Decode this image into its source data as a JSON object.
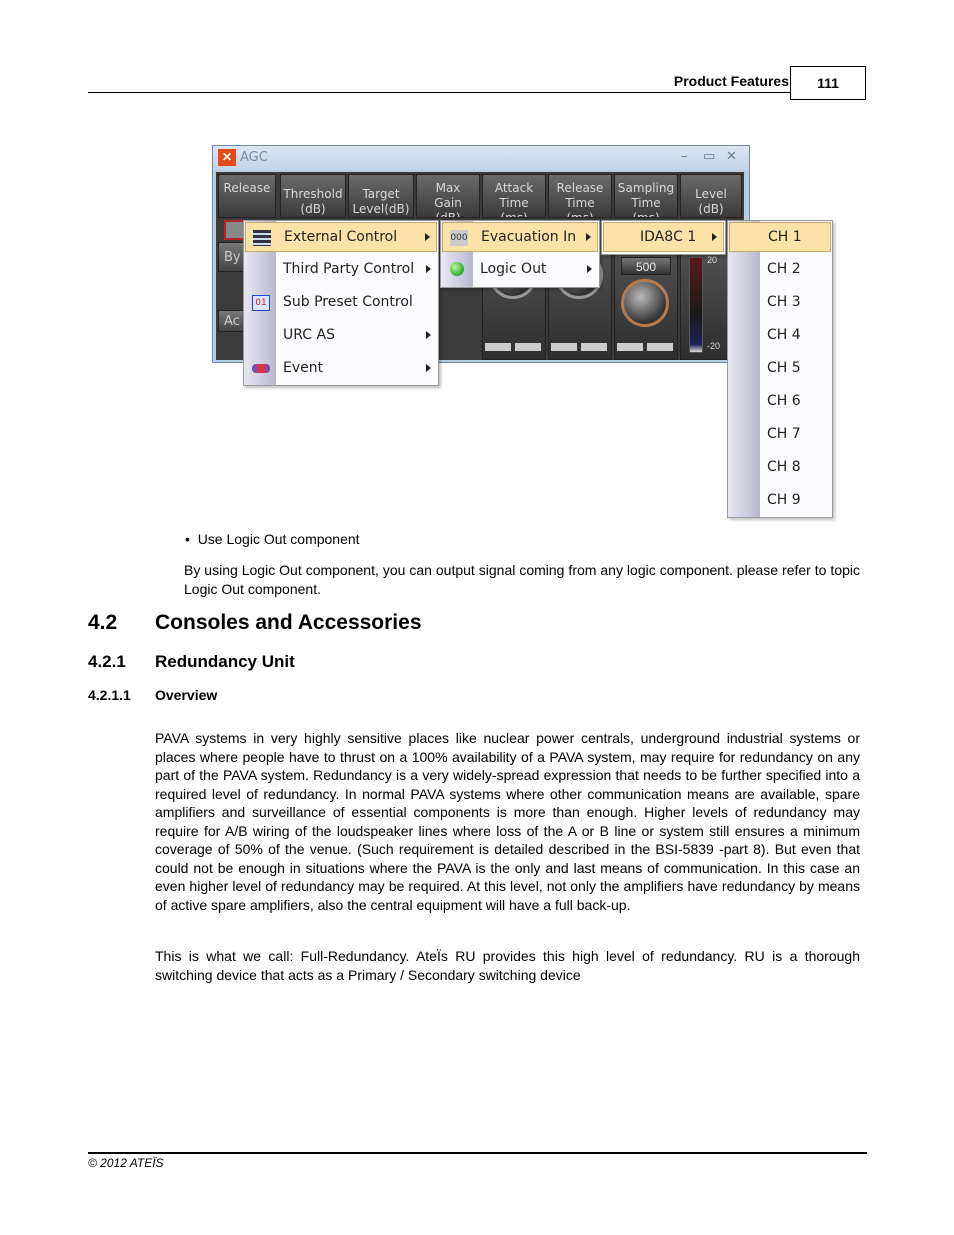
{
  "header": {
    "section_title": "Product Features",
    "page_number": "111"
  },
  "screenshot": {
    "window": {
      "title": "AGC",
      "controls": {
        "minimize": "–",
        "maximize": "▭",
        "close": "✕"
      },
      "column_headers": [
        "Release",
        "Threshold\n(dB)",
        "Target\nLevel(dB)",
        "Max\nGain\n(dB)",
        "Attack\nTime\n(ms)",
        "Release\nTime\n(ms)",
        "Sampling\nTime\n(ms)",
        "Level\n(dB)"
      ],
      "left_buttons": [
        "By",
        "Ac"
      ],
      "sampling_value": "500",
      "meter_top": "20",
      "meter_bottom": "-20"
    },
    "menu_main": {
      "items": [
        {
          "label": "External Control",
          "icon": "external-control-icon",
          "submenu": true,
          "highlighted": true
        },
        {
          "label": "Third Party Control",
          "icon": "",
          "submenu": true,
          "highlighted": false
        },
        {
          "label": "Sub Preset Control",
          "icon": "sub-preset-icon",
          "submenu": false,
          "highlighted": false
        },
        {
          "label": "URC AS",
          "icon": "",
          "submenu": true,
          "highlighted": false
        },
        {
          "label": "Event",
          "icon": "event-icon",
          "submenu": true,
          "highlighted": false
        }
      ]
    },
    "menu_external": {
      "items": [
        {
          "label": "Evacuation In",
          "icon": "evacuation-in-icon",
          "submenu": true,
          "highlighted": true
        },
        {
          "label": "Logic Out",
          "icon": "logic-out-icon",
          "submenu": true,
          "highlighted": false
        }
      ]
    },
    "menu_device": {
      "items": [
        {
          "label": "IDA8C 1",
          "submenu": true,
          "highlighted": true
        }
      ]
    },
    "menu_channels": {
      "items": [
        "CH 1",
        "CH 2",
        "CH 3",
        "CH 4",
        "CH 5",
        "CH 6",
        "CH 7",
        "CH 8",
        "CH 9"
      ],
      "highlighted_index": 0
    }
  },
  "content": {
    "bullet": "Use Logic Out component",
    "bullet_para": "By using Logic Out component, you can output signal coming from any logic component. please refer to topic Logic Out component.",
    "h2": {
      "num": "4.2",
      "title": "Consoles and Accessories"
    },
    "h3": {
      "num": "4.2.1",
      "title": "Redundancy Unit"
    },
    "h4": {
      "num": "4.2.1.1",
      "title": "Overview"
    },
    "para1": "PAVA systems in very highly sensitive places like nuclear power centrals, underground industrial systems or places where people have to thrust on a 100% availability of a PAVA system, may require for redundancy on any part of the PAVA system. Redundancy is a very widely-spread expression that needs to be further specified into a required level of redundancy. In normal PAVA systems where other communication means are available, spare amplifiers and surveillance of essential components is more than enough. Higher levels of redundancy may require for A/B wiring of the loudspeaker lines where loss of the A or B line or system still ensures a minimum coverage of 50% of the venue. (Such requirement is detailed described in the BSI-5839 -part 8). But even that could not be enough in situations where the PAVA is the only and last means of communication. In this case an even higher level of redundancy may be required. At this level, not only the amplifiers have redundancy by means of active spare amplifiers, also the central equipment will have a full back-up.",
    "para2": "This is what we call: Full-Redundancy. AteÏs RU provides this high level of redundancy. RU is a thorough switching device that acts as a Primary / Secondary switching device"
  },
  "footer": {
    "copyright": "© 2012 ATEÏS"
  }
}
